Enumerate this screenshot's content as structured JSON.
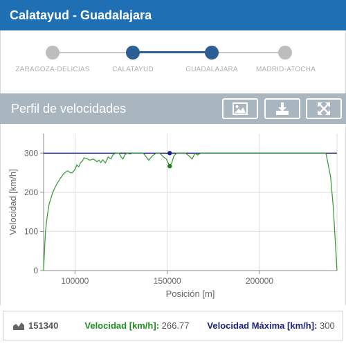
{
  "header": {
    "title": "Calatayud - Guadalajara"
  },
  "stepper": {
    "steps": [
      {
        "label": "ZARAGOZA-DELICIAS",
        "active": false
      },
      {
        "label": "CALATAYUD",
        "active": true
      },
      {
        "label": "GUADALAJARA",
        "active": true
      },
      {
        "label": "MADRID-ATOCHA",
        "active": false
      }
    ]
  },
  "panel": {
    "title": "Perfil de velocidades",
    "buttons": [
      "image-icon",
      "download-icon",
      "fullscreen-icon"
    ]
  },
  "chart_data": {
    "type": "line",
    "xlabel": "Posición [m]",
    "ylabel": "Velocidad [km/h]",
    "xlim": [
      83000,
      242000
    ],
    "ylim": [
      0,
      350
    ],
    "xticks": [
      100000,
      150000,
      200000
    ],
    "yticks": [
      0,
      100,
      200,
      300
    ],
    "grid": true,
    "series": [
      {
        "name": "Velocidad",
        "color": "#2e9a2e",
        "x": [
          83000,
          83500,
          84000,
          85000,
          86000,
          88000,
          90000,
          92000,
          94000,
          96000,
          97500,
          98500,
          100000,
          101000,
          102000,
          103000,
          104000,
          105000,
          106000,
          108000,
          110000,
          112000,
          113000,
          114000,
          115000,
          116500,
          118000,
          119500,
          120500,
          121500,
          123000,
          124000,
          125000,
          126000,
          127000,
          128000,
          129000,
          130000,
          131000,
          132000,
          134000,
          137000,
          140000,
          142000,
          144000,
          146000,
          148000,
          149500,
          151340,
          152500,
          153500,
          155000,
          157000,
          160000,
          162000,
          163500,
          165000,
          166500,
          168000,
          172000,
          180000,
          200000,
          220000,
          236000,
          238500,
          240000,
          241000,
          242000
        ],
        "y": [
          0,
          50,
          100,
          140,
          170,
          200,
          220,
          235,
          248,
          255,
          250,
          250,
          258,
          270,
          265,
          275,
          280,
          288,
          287,
          282,
          285,
          278,
          282,
          276,
          283,
          275,
          290,
          285,
          295,
          299,
          300,
          300,
          290,
          285,
          295,
          300,
          299,
          298,
          300,
          300,
          300,
          300,
          282,
          293,
          300,
          300,
          290,
          285,
          267,
          275,
          292,
          300,
          300,
          300,
          292,
          285,
          300,
          295,
          300,
          300,
          300,
          300,
          300,
          300,
          240,
          160,
          80,
          0
        ]
      },
      {
        "name": "Velocidad Máxima",
        "color": "#1a237e",
        "x": [
          83000,
          242000
        ],
        "y": [
          300,
          300
        ]
      }
    ],
    "cursor": {
      "x": 151340,
      "speed": 266.77,
      "max_speed": 300
    }
  },
  "info": {
    "position": "151340",
    "speed_label": "Velocidad [km/h]:",
    "speed_value": "266.77",
    "max_label": "Velocidad Máxima [km/h]:",
    "max_value": "300"
  }
}
